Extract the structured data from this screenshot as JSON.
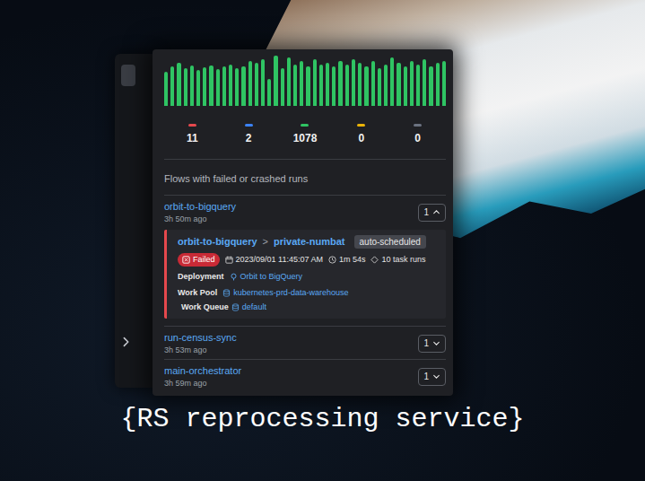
{
  "chart": {
    "values": [
      38,
      44,
      48,
      42,
      45,
      40,
      43,
      45,
      41,
      44,
      46,
      42,
      44,
      50,
      48,
      52,
      30,
      56,
      42,
      54,
      46,
      50,
      44,
      52,
      46,
      48,
      44,
      50,
      46,
      52,
      48,
      44,
      50,
      42,
      46,
      54,
      48,
      44,
      50,
      46,
      52,
      44,
      48,
      50
    ]
  },
  "stats": [
    {
      "count": "11",
      "color": "#e5484d"
    },
    {
      "count": "2",
      "color": "#3b82f6"
    },
    {
      "count": "1078",
      "color": "#2fc463"
    },
    {
      "count": "0",
      "color": "#eab308"
    },
    {
      "count": "0",
      "color": "#6b7280"
    }
  ],
  "section_title": "Flows with failed or crashed runs",
  "flows": [
    {
      "name": "orbit-to-bigquery",
      "time": "3h 50m ago",
      "count": "1",
      "expanded": true,
      "runs": [
        {
          "flow": "orbit-to-bigquery",
          "separator": ">",
          "name": "private-numbat",
          "tag": "auto-scheduled",
          "state": "Failed",
          "start": "2023/09/01 11:45:07 AM",
          "duration": "1m 54s",
          "task_runs": "10 task runs",
          "deployment_label": "Deployment",
          "deployment": "Orbit to BigQuery",
          "work_pool_label": "Work Pool",
          "work_pool": "kubernetes-prd-data-warehouse",
          "work_queue_label": "Work Queue",
          "work_queue": "default"
        }
      ]
    },
    {
      "name": "run-census-sync",
      "time": "3h 53m ago",
      "count": "1",
      "expanded": false,
      "runs": []
    },
    {
      "name": "main-orchestrator",
      "time": "3h 59m ago",
      "count": "1",
      "expanded": false,
      "runs": []
    }
  ],
  "caption": "{RS reprocessing service}"
}
